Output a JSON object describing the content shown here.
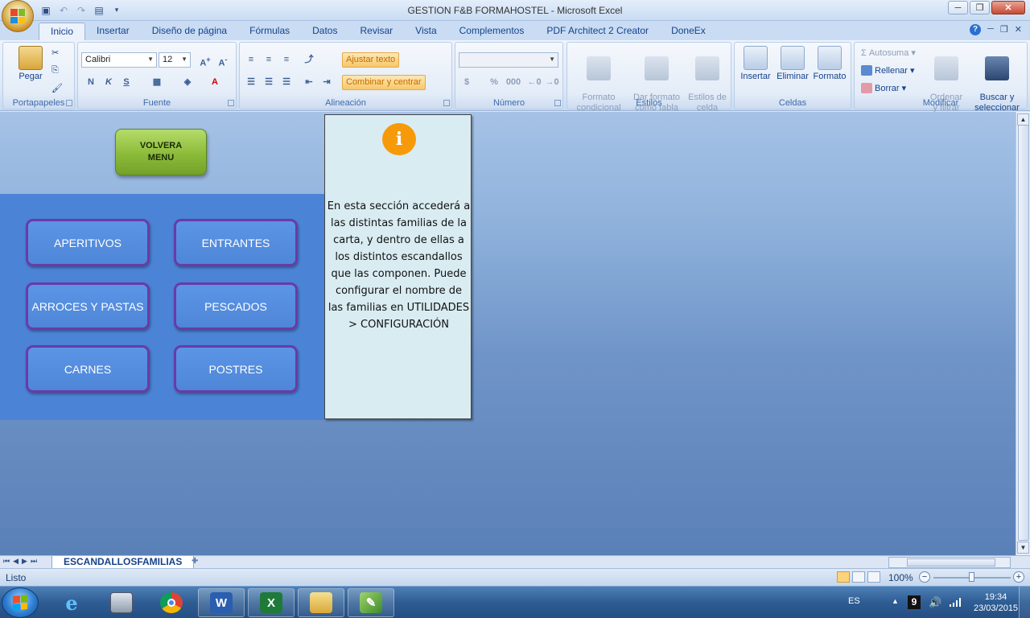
{
  "window": {
    "title": "GESTION F&B FORMAHOSTEL - Microsoft Excel",
    "minimize": "─",
    "restore": "❐",
    "close": "✕"
  },
  "ribbon_tabs": [
    "Inicio",
    "Insertar",
    "Diseño de página",
    "Fórmulas",
    "Datos",
    "Revisar",
    "Vista",
    "Complementos",
    "PDF Architect 2 Creator",
    "DoneEx"
  ],
  "ribbon": {
    "portapapeles": {
      "label": "Portapapeles",
      "pegar": "Pegar"
    },
    "fuente": {
      "label": "Fuente",
      "font": "Calibri",
      "size": "12",
      "bold": "N",
      "italic": "K",
      "underline": "S"
    },
    "alineacion": {
      "label": "Alineación",
      "ajustar": "Ajustar texto",
      "combinar": "Combinar y centrar"
    },
    "numero": {
      "label": "Número",
      "percent": "%",
      "thousands": "000"
    },
    "estilos": {
      "label": "Estilos",
      "formato_condicional": "Formato\ncondicional",
      "dar_formato": "Dar formato\ncomo tabla",
      "estilos_celda": "Estilos de\ncelda"
    },
    "celdas": {
      "label": "Celdas",
      "insertar": "Insertar",
      "eliminar": "Eliminar",
      "formato": "Formato"
    },
    "modificar": {
      "label": "Modificar",
      "autosuma": "Autosuma",
      "rellenar": "Rellenar",
      "borrar": "Borrar",
      "ordenar": "Ordenar\ny filtrar",
      "buscar": "Buscar y\nseleccionar"
    }
  },
  "sheet": {
    "volver_button": "VOLVERA\nMENU",
    "families": [
      "APERITIVOS",
      "ENTRANTES",
      "ARROCES Y PASTAS",
      "PESCADOS",
      "CARNES",
      "POSTRES"
    ],
    "info_text": "En esta sección accederá a las distintas familias de la carta, y dentro de ellas a los distintos escandallos que las componen. Puede configurar el nombre de las familias en UTILIDADES > CONFIGURACIÓN",
    "info_icon": "i"
  },
  "sheet_tab": "ESCANDALLOSFAMILIAS",
  "status": {
    "text": "Listo",
    "zoom": "100%"
  },
  "taskbar": {
    "lang": "ES",
    "badge": "9",
    "time": "19:34",
    "date": "23/03/2015"
  },
  "colors": {
    "volver": "#8cbb39",
    "family_bg": "#4f86d8",
    "family_border": "#6a3aa8",
    "info_bg": "#d9ecf2",
    "info_icon": "#f79a0a",
    "panel_bg": "#4b84d6"
  }
}
